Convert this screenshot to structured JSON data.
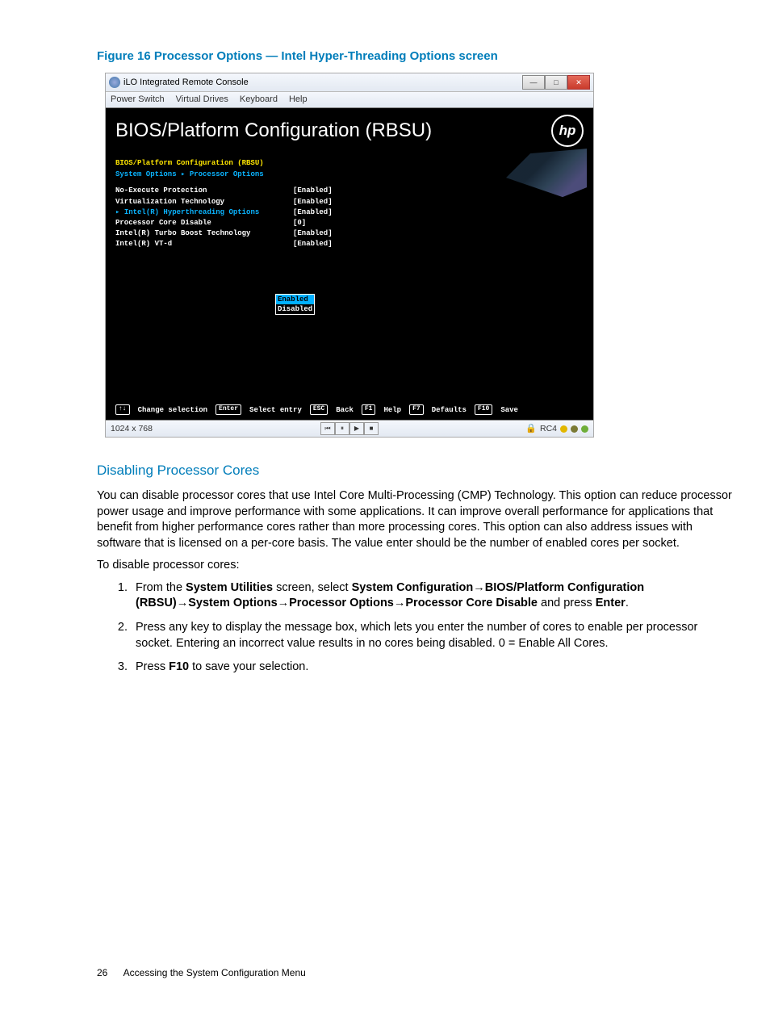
{
  "figure": {
    "caption": "Figure 16 Processor Options — Intel Hyper-Threading Options screen"
  },
  "screenshot": {
    "titlebar": {
      "title": "iLO Integrated Remote Console"
    },
    "menubar": {
      "items": [
        "Power Switch",
        "Virtual Drives",
        "Keyboard",
        "Help"
      ]
    },
    "bios": {
      "title": "BIOS/Platform Configuration (RBSU)",
      "breadcrumb1": "BIOS/Platform Configuration (RBSU)",
      "breadcrumb2": "System Options ▸ Processor Options",
      "options": [
        {
          "label": "No-Execute Protection",
          "value": "[Enabled]",
          "style": "white"
        },
        {
          "label": "Virtualization Technology",
          "value": "[Enabled]",
          "style": "white"
        },
        {
          "label": "Intel(R) Hyperthreading Options",
          "value": "[Enabled]",
          "style": "blue"
        },
        {
          "label": "Processor Core Disable",
          "value": "[0]",
          "style": "white"
        },
        {
          "label": "Intel(R) Turbo Boost Technology",
          "value": "[Enabled]",
          "style": "white"
        },
        {
          "label": "Intel(R) VT-d",
          "value": "[Enabled]",
          "style": "white"
        }
      ],
      "dropdown": {
        "selected": "Enabled",
        "other": "Disabled"
      },
      "keys": [
        {
          "key": "↑↓",
          "label": "Change selection"
        },
        {
          "key": "Enter",
          "label": "Select entry"
        },
        {
          "key": "ESC",
          "label": "Back"
        },
        {
          "key": "F1",
          "label": "Help"
        },
        {
          "key": "F7",
          "label": "Defaults"
        },
        {
          "key": "F10",
          "label": "Save"
        }
      ]
    },
    "statusbar": {
      "resolution": "1024 x 768",
      "enc": "RC4"
    }
  },
  "section": {
    "heading": "Disabling Processor Cores",
    "para1": "You can disable processor cores that use Intel Core Multi-Processing (CMP) Technology. This option can reduce processor power usage and improve performance with some applications. It can improve overall performance for applications that benefit from higher performance cores rather than more processing cores. This option can also address issues with software that is licensed on a per-core basis. The value enter should be the number of enabled cores per socket.",
    "para2": "To disable processor cores:",
    "step1": {
      "t1": "From the ",
      "b1": "System Utilities",
      "t2": " screen, select ",
      "b2": "System Configuration",
      "arrow": "→",
      "b3": "BIOS/Platform Configuration (RBSU)",
      "b4": "System Options",
      "b5": "Processor Options",
      "b6": "Processor Core Disable",
      "t3": " and press ",
      "b7": "Enter",
      "t4": "."
    },
    "step2": "Press any key to display the message box, which lets you enter the number of cores to enable per processor socket. Entering an incorrect value results in no cores being disabled. 0 = Enable All Cores.",
    "step3": {
      "t1": "Press ",
      "b1": "F10",
      "t2": " to save your selection."
    }
  },
  "footer": {
    "page": "26",
    "title": "Accessing the System Configuration Menu"
  }
}
